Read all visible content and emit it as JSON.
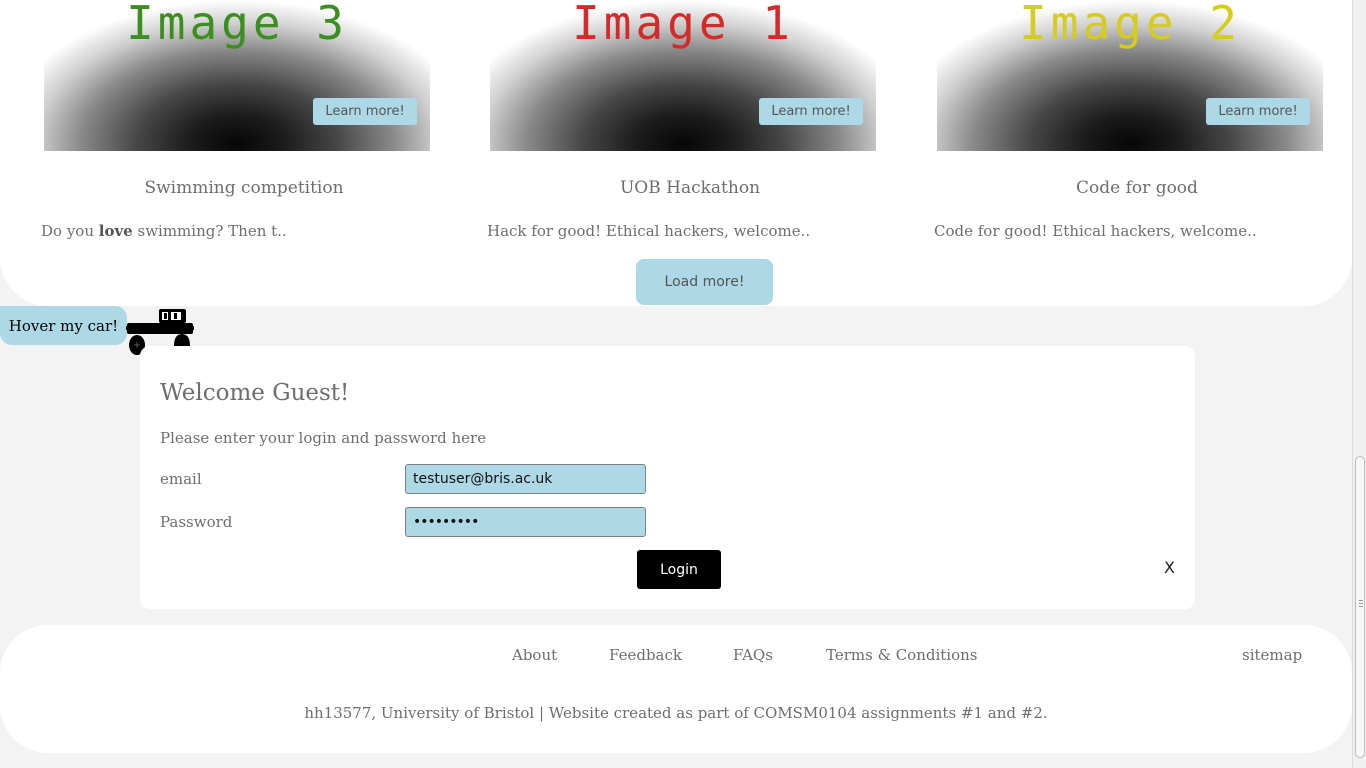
{
  "events": {
    "cards": [
      {
        "image_text": "Image 3",
        "image_color": "#3a8f1e",
        "learn_more": "Learn more!",
        "title": "Swimming competition",
        "desc_before": "Do you ",
        "desc_bold": "love",
        "desc_after": " swimming? Then t.."
      },
      {
        "image_text": "Image 1",
        "image_color": "#d42a2a",
        "learn_more": "Learn more!",
        "title": "UOB Hackathon",
        "desc_before": "Hack for good! Ethical hackers, welcome..",
        "desc_bold": "",
        "desc_after": ""
      },
      {
        "image_text": "Image 2",
        "image_color": "#d6cc1f",
        "learn_more": "Learn more!",
        "title": "Code for good",
        "desc_before": "Code for good! Ethical hackers, welcome..",
        "desc_bold": "",
        "desc_after": ""
      }
    ],
    "load_more": "Load more!"
  },
  "hover_car": {
    "label": "Hover my car!",
    "icon": "car-icon"
  },
  "login": {
    "title": "Welcome Guest!",
    "subtitle": "Please enter your login and password here",
    "email_label": "email",
    "email_value": "testuser@bris.ac.uk",
    "password_label": "Password",
    "password_value": "•••••••••",
    "login_button": "Login",
    "close": "X"
  },
  "footer": {
    "links": [
      "About",
      "Feedback",
      "FAQs",
      "Terms & Conditions"
    ],
    "sitemap": "sitemap",
    "credit": "hh13577, University of Bristol | Website created as part of COMSM0104 assignments #1 and #2."
  },
  "colors": {
    "accent": "#add8e6",
    "background": "#f3f3f3",
    "button_dark": "#000000"
  }
}
